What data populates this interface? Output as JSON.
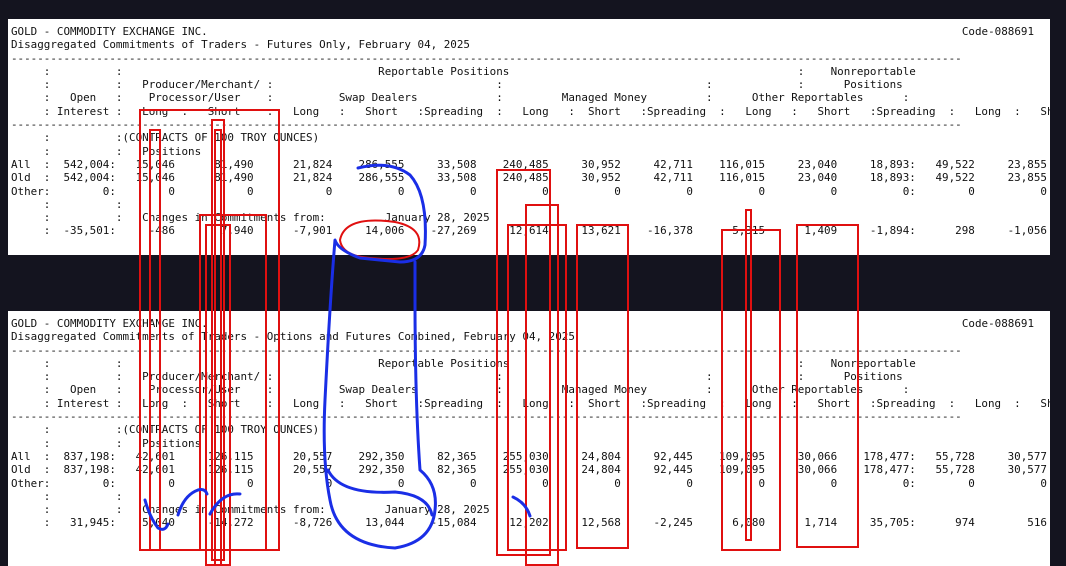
{
  "reports": [
    {
      "code": "Code-088691",
      "lines": [
        "GOLD - COMMODITY EXCHANGE INC.",
        "Disaggregated Commitments of Traders - Futures Only, February 04, 2025",
        "-------------------------------------------------------------------------------------------------------------------------------------------------",
        "     :          :                                       Reportable Positions                                            :    Nonreportable",
        "     :          :   Producer/Merchant/ :                                  :                               :             :      Positions",
        "     :   Open   :    Processor/User    :          Swap Dealers            :         Managed Money         :      Other Reportables      :",
        "     : Interest :   Long  :   Short    :   Long   :   Short   :Spreading  :   Long   :  Short   :Spreading  :   Long   :   Short   :Spreading  :   Long  :   Short",
        "-------------------------------------------------------------------------------------------------------------------------------------------------",
        "     :          :(CONTRACTS OF 100 TROY OUNCES)",
        "     :          :   Positions",
        "All  :  542,004:   15,046      81,490      21,824    286,555     33,508    240,485     30,952     42,711    116,015     23,040     18,893:   49,522     23,855",
        "Old  :  542,004:   15,046      81,490      21,824    286,555     33,508    240,485     30,952     42,711    116,015     23,040     18,893:   49,522     23,855",
        "Other:        0:        0           0           0          0          0          0          0          0          0          0          0:        0          0",
        "     :          :",
        "     :          :   Changes in Commitments from:         January 28, 2025",
        "     :  -35,501:     -486       7,940      -7,901     14,006    -27,269     12,614     13,621    -16,378      5,315      1,409     -1,894:      298     -1,056"
      ]
    },
    {
      "code": "Code-088691",
      "lines": [
        "GOLD - COMMODITY EXCHANGE INC.",
        "Disaggregated Commitments of Traders - Options and Futures Combined, February 04, 2025",
        "-------------------------------------------------------------------------------------------------------------------------------------------------",
        "     :          :                                       Reportable Positions                                            :    Nonreportable",
        "     :          :   Producer/Merchant/ :                                  :                               :             :      Positions",
        "     :   Open   :    Processor/User    :          Swap Dealers            :         Managed Money         :      Other Reportables      :",
        "     : Interest :   Long  :   Short    :   Long   :   Short   :Spreading  :   Long   :  Short   :Spreading  :   Long   :   Short   :Spreading  :   Long  :   Short",
        "-------------------------------------------------------------------------------------------------------------------------------------------------",
        "     :          :(CONTRACTS OF 100 TROY OUNCES)",
        "     :          :   Positions",
        "All  :  837,198:   42,601     126,115      20,557    292,350     82,365    255,030     24,804     92,445    109,095     30,066    178,477:   55,728     30,577",
        "Old  :  837,198:   42,601     126,115      20,557    292,350     82,365    255,030     24,804     92,445    109,095     30,066    178,477:   55,728     30,577",
        "Other:        0:        0           0           0          0          0          0          0          0          0          0          0:        0          0",
        "     :          :",
        "     :          :   Changes in Commitments from:         January 28, 2025",
        "     :   31,945:    5,040     -14,272      -8,726     13,044    -15,084     12,202     12,568     -2,245      6,080      1,714     35,705:      974        516"
      ]
    }
  ],
  "colors": {
    "background": "#14141f",
    "panel": "#ffffff",
    "text": "#111111",
    "annotation_red": "#e01010",
    "annotation_blue": "#1a2ee6"
  }
}
